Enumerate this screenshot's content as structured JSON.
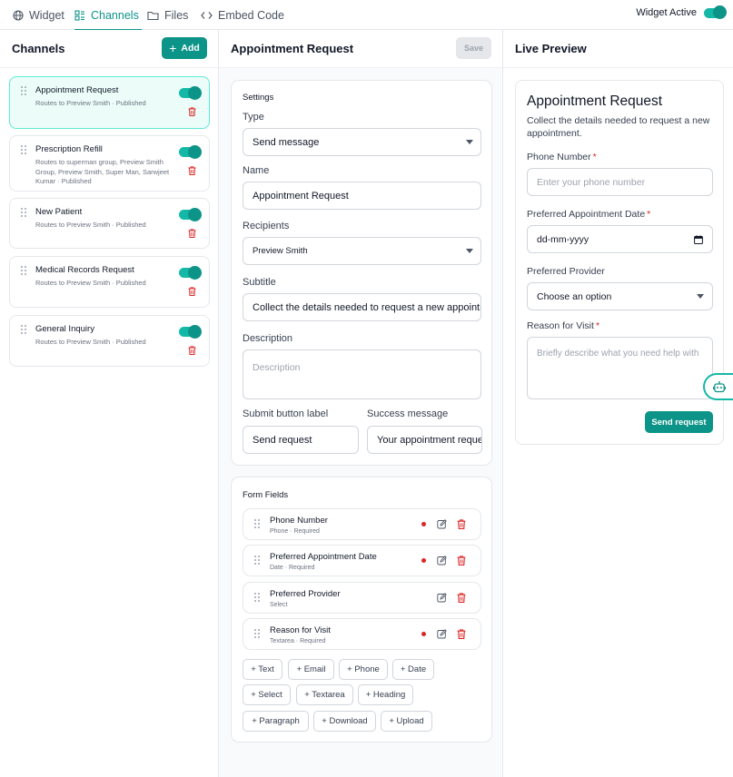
{
  "nav": {
    "tabs": [
      {
        "label": "Widget",
        "icon": "globe-icon"
      },
      {
        "label": "Channels",
        "icon": "channels-icon",
        "active": true
      },
      {
        "label": "Files",
        "icon": "folder-icon"
      },
      {
        "label": "Embed Code",
        "icon": "code-icon"
      }
    ],
    "widget_active_label": "Widget Active",
    "widget_active": true
  },
  "channels": {
    "title": "Channels",
    "add_label": "Add",
    "items": [
      {
        "name": "Appointment Request",
        "sub": "Routes to Preview Smith · Published",
        "enabled": true,
        "active": true
      },
      {
        "name": "Prescription Refill",
        "sub": "Routes to superman group, Preview Smith Group, Preview Smith, Super Man, Sarwjeet Kumar · Published",
        "enabled": true
      },
      {
        "name": "New Patient",
        "sub": "Routes to Preview Smith · Published",
        "enabled": true
      },
      {
        "name": "Medical Records Request",
        "sub": "Routes to Preview Smith · Published",
        "enabled": true
      },
      {
        "name": "General Inquiry",
        "sub": "Routes to Preview Smith · Published",
        "enabled": true
      }
    ]
  },
  "editor": {
    "title": "Appointment Request",
    "save_label": "Save",
    "settings": {
      "title": "Settings",
      "type_label": "Type",
      "type_value": "Send message",
      "name_label": "Name",
      "name_value": "Appointment Request",
      "recipients_label": "Recipients",
      "recipients_value": "Preview Smith",
      "subtitle_label": "Subtitle",
      "subtitle_value": "Collect the details needed to request a new appointment.",
      "description_label": "Description",
      "description_placeholder": "Description",
      "submit_label": "Submit button label",
      "submit_value": "Send request",
      "success_label": "Success message",
      "success_value": "Your appointment request has been sent."
    },
    "form_fields": {
      "title": "Form Fields",
      "items": [
        {
          "name": "Phone Number",
          "sub": "Phone · Required",
          "required": true
        },
        {
          "name": "Preferred Appointment Date",
          "sub": "Date · Required",
          "required": true
        },
        {
          "name": "Preferred Provider",
          "sub": "Select",
          "required": false
        },
        {
          "name": "Reason for Visit",
          "sub": "Textarea · Required",
          "required": true
        }
      ],
      "add_buttons": [
        "+ Text",
        "+ Email",
        "+ Phone",
        "+ Date",
        "+ Select",
        "+ Textarea",
        "+ Heading",
        "+ Paragraph",
        "+ Download",
        "+ Upload"
      ]
    }
  },
  "preview": {
    "title": "Live Preview",
    "form_title": "Appointment Request",
    "form_subtitle": "Collect the details needed to request a new appointment.",
    "phone_label": "Phone Number",
    "phone_placeholder": "Enter your phone number",
    "date_label": "Preferred Appointment Date",
    "date_placeholder": "dd-mm-yyyy",
    "provider_label": "Preferred Provider",
    "provider_placeholder": "Choose an option",
    "reason_label": "Reason for Visit",
    "reason_placeholder": "Briefly describe what you need help with",
    "required_mark": "*",
    "send_label": "Send request"
  },
  "colors": {
    "accent": "#0d9488",
    "danger": "#dc2626"
  }
}
